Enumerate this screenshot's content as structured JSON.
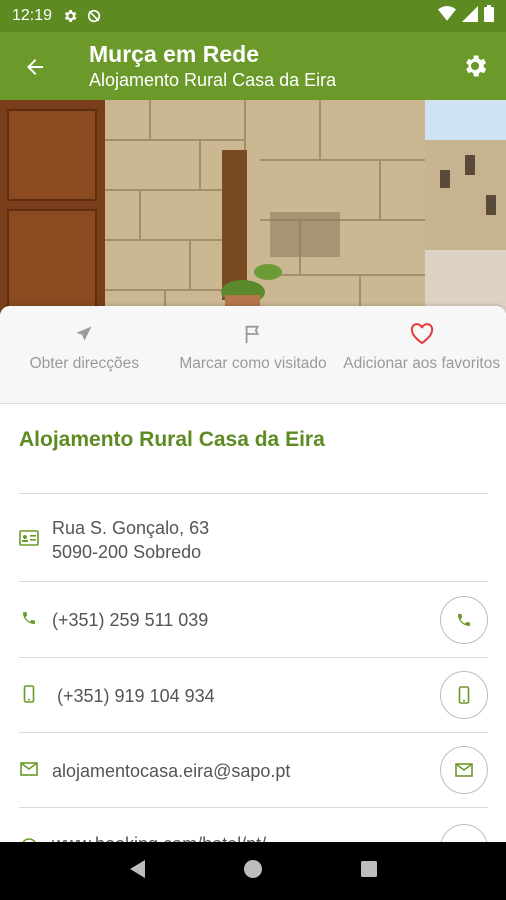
{
  "status_bar": {
    "time": "12:19",
    "icons": [
      "gear-icon",
      "no-sync-icon",
      "wifi-icon",
      "signal-icon",
      "battery-icon"
    ]
  },
  "app_bar": {
    "title": "Murça em Rede",
    "subtitle": "Alojamento Rural Casa da Eira",
    "back_icon": "arrow-left-icon",
    "settings_icon": "gear-icon"
  },
  "actions": [
    {
      "label": "Obter direcções",
      "icon": "navigation-arrow-icon"
    },
    {
      "label": "Marcar como visitado",
      "icon": "flag-icon"
    },
    {
      "label": "Adicionar aos favoritos",
      "icon": "heart-icon"
    }
  ],
  "place": {
    "title": "Alojamento Rural Casa da Eira",
    "address_line1": "Rua S. Gonçalo, 63",
    "address_line2": "5090-200 Sobredo",
    "phone": "(+351) 259 511 039",
    "mobile": "(+351) 919 104 934",
    "email": "alojamentocasa.eira@sapo.pt",
    "website": "www.booking.com/hotel/pt/"
  },
  "colors": {
    "primary": "#6b9a2a",
    "status": "#5e8a22",
    "accent_heart": "#e23b3b"
  }
}
